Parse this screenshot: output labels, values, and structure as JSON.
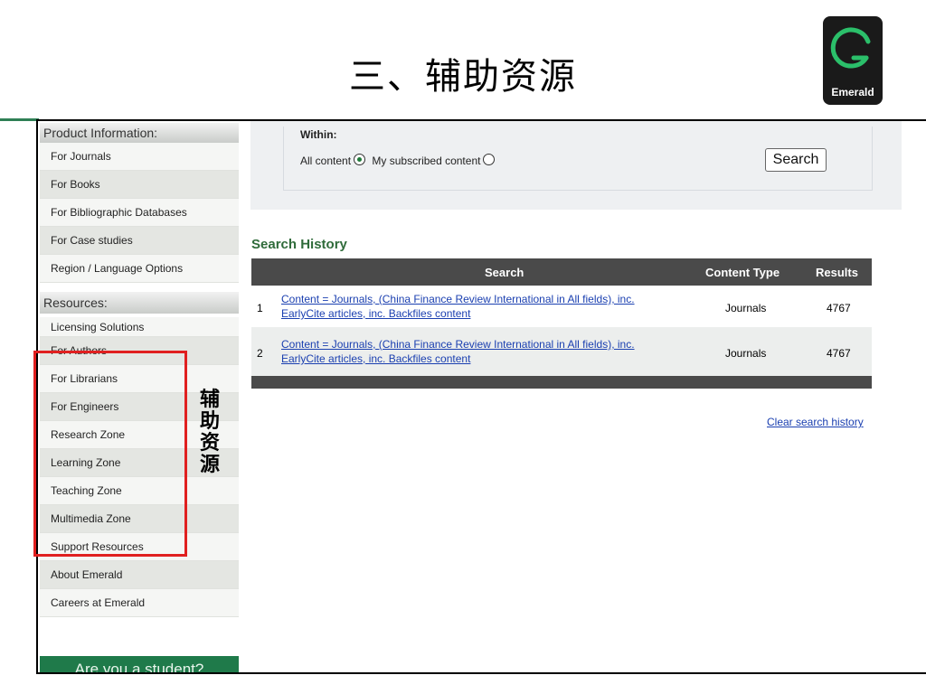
{
  "slide": {
    "title": "三、辅助资源",
    "annotation": "辅助资源"
  },
  "logo": {
    "text": "Emerald"
  },
  "sidebar": {
    "product_heading": "Product Information:",
    "product_items": [
      "For Journals",
      "For Books",
      "For Bibliographic Databases",
      "For Case studies",
      "Region / Language Options"
    ],
    "resources_heading": "Resources:",
    "resource_items": [
      "Licensing Solutions",
      "For Authors",
      "For Librarians",
      "For Engineers",
      "Research Zone",
      "Learning Zone",
      "Teaching Zone",
      "Multimedia Zone",
      "Support Resources",
      "About Emerald",
      "Careers at Emerald"
    ],
    "student_banner": "Are you a student?"
  },
  "search_form": {
    "within_label": "Within:",
    "option_all": "All content",
    "option_subscribed": "My subscribed content",
    "selected": "All content",
    "search_button": "Search"
  },
  "search_history": {
    "title": "Search History",
    "columns": [
      "Search",
      "Content Type",
      "Results"
    ],
    "rows": [
      {
        "num": "1",
        "query_line1": "Content = Journals, (China Finance Review International in All fields), inc.",
        "query_line2": "EarlyCite articles, inc. Backfiles content",
        "content_type": "Journals",
        "results": "4767"
      },
      {
        "num": "2",
        "query_line1": "Content = Journals, (China Finance Review International in All fields), inc.",
        "query_line2": "EarlyCite articles, inc. Backfiles content",
        "content_type": "Journals",
        "results": "4767"
      }
    ],
    "clear_link": "Clear search history"
  },
  "colors": {
    "accent_green": "#2f6b3a",
    "annotation_red": "#e02020",
    "link_blue": "#1a3fb0",
    "header_dark": "#4a4a4a"
  }
}
